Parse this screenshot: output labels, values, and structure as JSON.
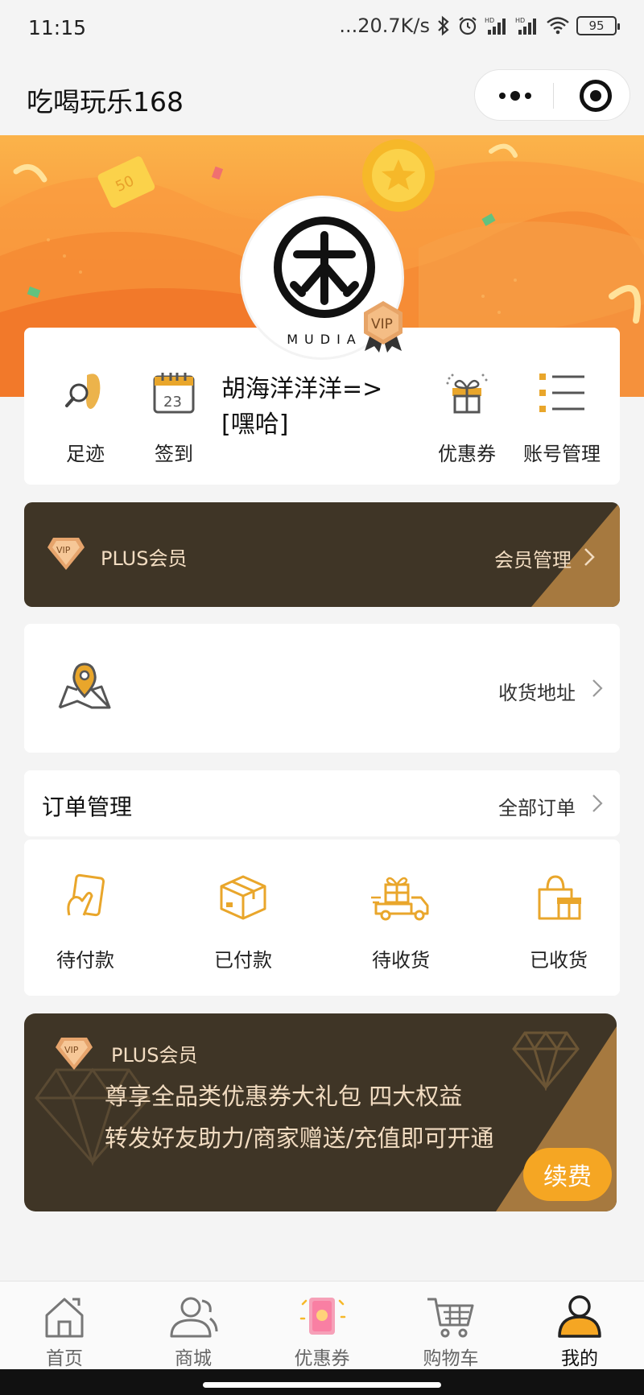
{
  "status": {
    "time": "11:15",
    "net_speed": "...20.7K/s",
    "battery": "95"
  },
  "header": {
    "app_title": "吃喝玩乐168"
  },
  "avatar": {
    "brand_text": "MUDIA",
    "badge": "VIP"
  },
  "profile": {
    "username": "胡海洋洋洋=>[嘿哈]",
    "items": [
      {
        "label": "足迹",
        "icon": "footprint-icon"
      },
      {
        "label": "签到",
        "icon": "calendar-icon"
      },
      {
        "label": "优惠券",
        "icon": "gift-icon"
      },
      {
        "label": "账号管理",
        "icon": "list-icon"
      }
    ],
    "calendar_day": "23"
  },
  "plus_row": {
    "label": "PLUS会员",
    "manage_label": "会员管理",
    "gem_text": "VIP"
  },
  "address": {
    "label": "收货地址"
  },
  "orders": {
    "title": "订单管理",
    "all_label": "全部订单",
    "items": [
      {
        "label": "待付款",
        "icon": "card-payment-icon"
      },
      {
        "label": "已付款",
        "icon": "package-icon"
      },
      {
        "label": "待收货",
        "icon": "delivery-truck-icon"
      },
      {
        "label": "已收货",
        "icon": "gift-bag-icon"
      }
    ]
  },
  "promo": {
    "title": "PLUS会员",
    "line1": "尊享全品类优惠券大礼包  四大权益",
    "line2": "转发好友助力/商家赠送/充值即可开通",
    "renew_label": "续费",
    "gem_text": "VIP"
  },
  "tabbar": {
    "items": [
      {
        "label": "首页",
        "icon": "home-icon"
      },
      {
        "label": "商城",
        "icon": "users-icon"
      },
      {
        "label": "优惠券",
        "icon": "coupon-icon"
      },
      {
        "label": "购物车",
        "icon": "cart-icon"
      },
      {
        "label": "我的",
        "icon": "profile-icon"
      }
    ],
    "active_index": 4
  },
  "colors": {
    "accent": "#e9a62b",
    "plus_bg": "#3f3526",
    "plus_text": "#f2dcc1",
    "renew": "#f5a623"
  }
}
